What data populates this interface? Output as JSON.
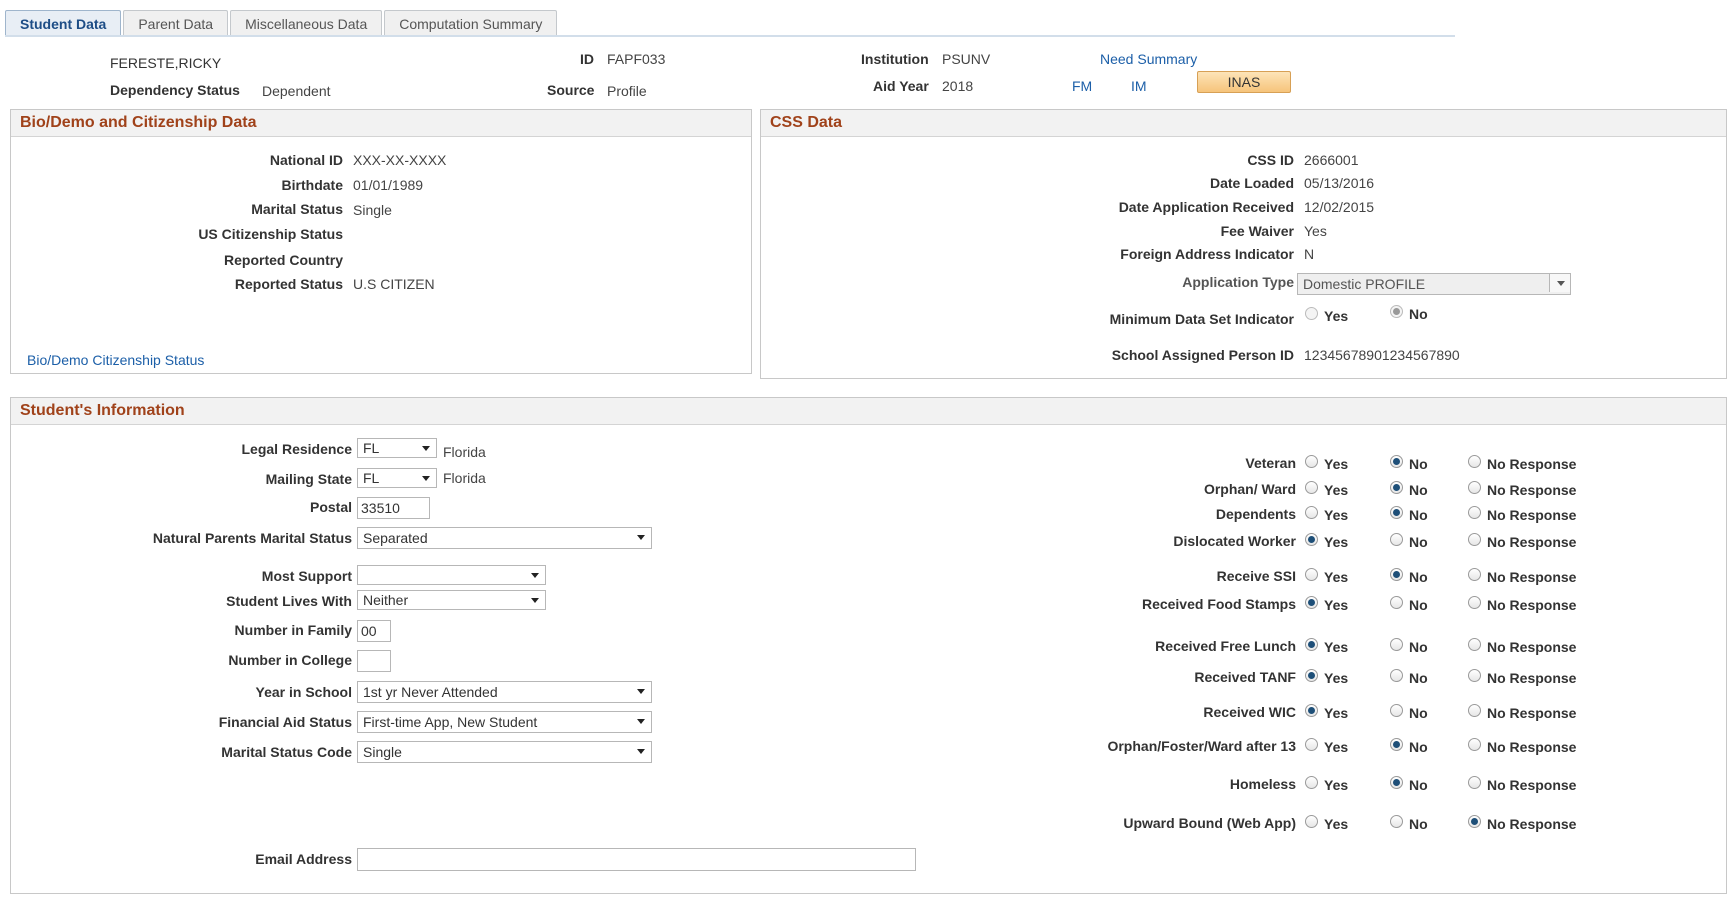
{
  "tabs": [
    {
      "label": "Student Data"
    },
    {
      "label": "Parent Data"
    },
    {
      "label": "Miscellaneous Data"
    },
    {
      "label": "Computation Summary"
    }
  ],
  "header": {
    "student_name": "FERESTE,RICKY",
    "dependency_status_label": "Dependency Status",
    "dependency_status_value": "Dependent",
    "id_label": "ID",
    "id_value": "FAPF033",
    "source_label": "Source",
    "source_value": "Profile",
    "institution_label": "Institution",
    "institution_value": "PSUNV",
    "aid_year_label": "Aid Year",
    "aid_year_value": "2018",
    "need_summary_link": "Need Summary",
    "fm_link": "FM",
    "im_link": "IM",
    "inas_button": "INAS"
  },
  "bio": {
    "title": "Bio/Demo and Citizenship Data",
    "rows": [
      {
        "label": "National ID",
        "value": "XXX-XX-XXXX"
      },
      {
        "label": "Birthdate",
        "value": "01/01/1989"
      },
      {
        "label": "Marital Status",
        "value": "Single"
      },
      {
        "label": "US Citizenship Status",
        "value": ""
      },
      {
        "label": "Reported Country",
        "value": ""
      },
      {
        "label": "Reported Status",
        "value": "U.S CITIZEN"
      }
    ],
    "link": "Bio/Demo Citizenship Status"
  },
  "css": {
    "title": "CSS Data",
    "rows": [
      {
        "label": "CSS ID",
        "value": "2666001"
      },
      {
        "label": "Date Loaded",
        "value": "05/13/2016"
      },
      {
        "label": "Date Application Received",
        "value": "12/02/2015"
      },
      {
        "label": "Fee Waiver",
        "value": "Yes"
      },
      {
        "label": "Foreign Address Indicator",
        "value": "N"
      }
    ],
    "application_type_label": "Application Type",
    "application_type_value": "Domestic PROFILE",
    "min_data_label": "Minimum Data Set Indicator",
    "min_yes": "Yes",
    "min_no": "No",
    "school_id_label": "School Assigned Person ID",
    "school_id_value": "12345678901234567890"
  },
  "student": {
    "title": "Student's Information",
    "legal_residence_label": "Legal Residence",
    "legal_residence_value": "FL",
    "legal_residence_desc": "Florida",
    "mailing_state_label": "Mailing State",
    "mailing_state_value": "FL",
    "mailing_state_desc": "Florida",
    "postal_label": "Postal",
    "postal_value": "33510",
    "parents_marital_label": "Natural Parents Marital Status",
    "parents_marital_value": "Separated",
    "most_support_label": "Most Support",
    "most_support_value": "",
    "lives_with_label": "Student Lives With",
    "lives_with_value": "Neither",
    "num_family_label": "Number in Family",
    "num_family_value": "00",
    "num_college_label": "Number in College",
    "num_college_value": "",
    "year_school_label": "Year in School",
    "year_school_value": "1st yr Never Attended",
    "fa_status_label": "Financial Aid Status",
    "fa_status_value": "First-time App, New Student",
    "marital_code_label": "Marital Status Code",
    "marital_code_value": "Single",
    "email_label": "Email Address",
    "email_value": "",
    "opt_yes": "Yes",
    "opt_no": "No",
    "opt_nr": "No Response",
    "indicators": [
      {
        "label": "Veteran",
        "selected": "No"
      },
      {
        "label": "Orphan/ Ward",
        "selected": "No"
      },
      {
        "label": "Dependents",
        "selected": "No"
      },
      {
        "label": "Dislocated Worker",
        "selected": "Yes"
      },
      {
        "label": "Receive SSI",
        "selected": "No"
      },
      {
        "label": "Received Food Stamps",
        "selected": "Yes"
      },
      {
        "label": "Received Free Lunch",
        "selected": "Yes"
      },
      {
        "label": "Received TANF",
        "selected": "Yes"
      },
      {
        "label": "Received WIC",
        "selected": "Yes"
      },
      {
        "label": "Orphan/Foster/Ward after 13",
        "selected": "No"
      },
      {
        "label": "Homeless",
        "selected": "No"
      },
      {
        "label": "Upward Bound (Web App)",
        "selected": "No Response"
      }
    ]
  }
}
